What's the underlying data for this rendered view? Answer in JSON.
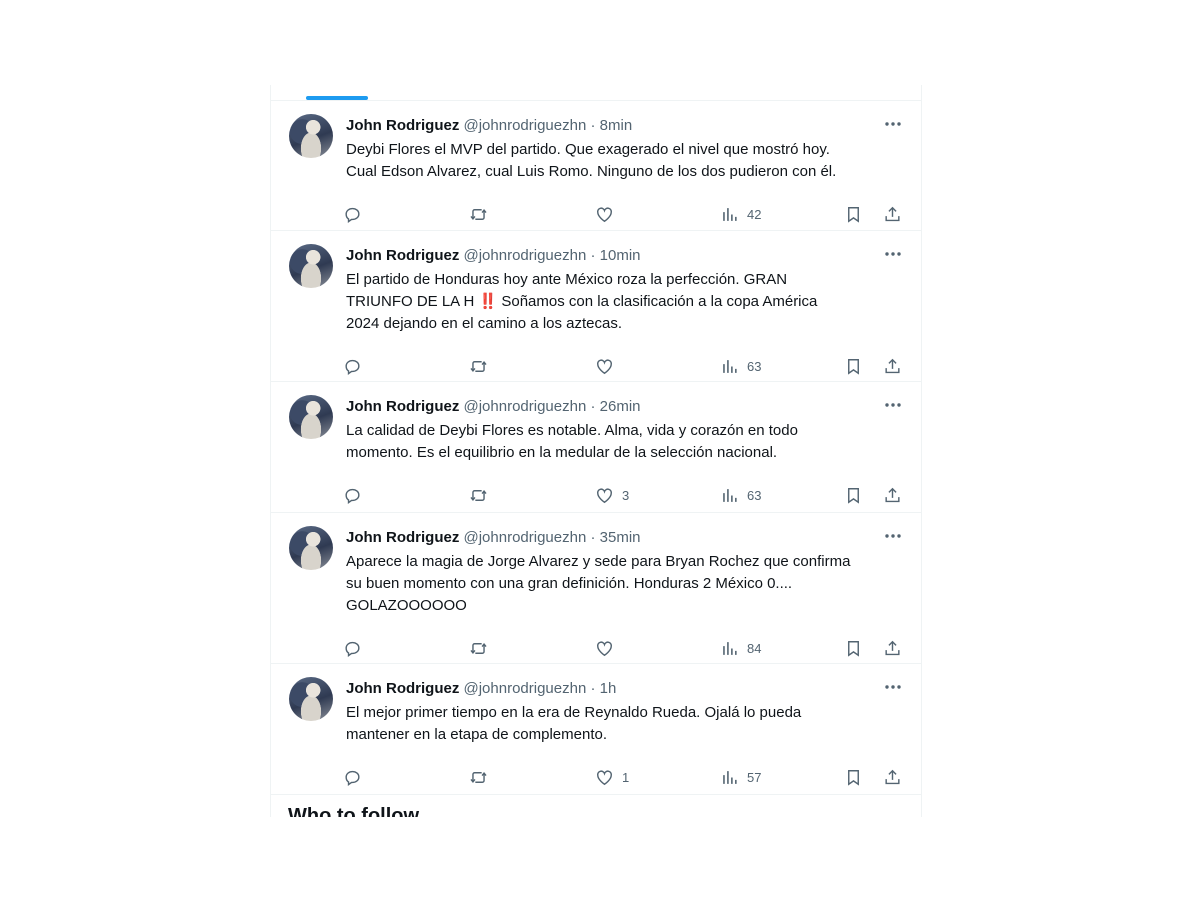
{
  "section_heading": "Who to follow",
  "tweets": [
    {
      "name": "John Rodriguez",
      "handle": "@johnrodriguezhn",
      "sep": "·",
      "time": "8min",
      "lines": [
        "Deybi Flores el MVP del partido. Que exagerado el nivel que mostró hoy.",
        "Cual Edson Alvarez, cual Luis Romo. Ninguno de los dos pudieron con él."
      ],
      "likes": "",
      "views": "42"
    },
    {
      "name": "John Rodriguez",
      "handle": "@johnrodriguezhn",
      "sep": "·",
      "time": "10min",
      "lines": [
        "El partido de Honduras hoy ante México roza la perfección. GRAN",
        "TRIUNFO DE LA  H ‼️ Soñamos con la clasificación a la copa América",
        "2024 dejando en el camino a los aztecas."
      ],
      "likes": "",
      "views": "63"
    },
    {
      "name": "John Rodriguez",
      "handle": "@johnrodriguezhn",
      "sep": "·",
      "time": "26min",
      "lines": [
        "La calidad de Deybi Flores es notable. Alma, vida y corazón en todo",
        "momento. Es el equilibrio en la medular de la selección nacional."
      ],
      "likes": "3",
      "views": "63"
    },
    {
      "name": "John Rodriguez",
      "handle": "@johnrodriguezhn",
      "sep": "·",
      "time": "35min",
      "lines": [
        "Aparece la magia de Jorge Alvarez y sede para Bryan Rochez que confirma",
        "su buen momento con una gran definición. Honduras 2 México 0....",
        "GOLAZOOOOOO"
      ],
      "likes": "",
      "views": "84"
    },
    {
      "name": "John Rodriguez",
      "handle": "@johnrodriguezhn",
      "sep": "·",
      "time": "1h",
      "lines": [
        "El mejor primer tiempo en la era de Reynaldo Rueda. Ojalá lo pueda",
        "mantener en la etapa de complemento."
      ],
      "likes": "1",
      "views": "57"
    }
  ],
  "icons": {
    "reply": "reply-icon",
    "retweet": "retweet-icon",
    "like": "heart-icon",
    "views": "views-icon",
    "bookmark": "bookmark-icon",
    "share": "share-icon",
    "more": "more-icon"
  },
  "colors": {
    "accent": "#1d9bf0",
    "secondary_text": "#536471",
    "primary_text": "#0f1419",
    "divider": "#eff3f4"
  }
}
